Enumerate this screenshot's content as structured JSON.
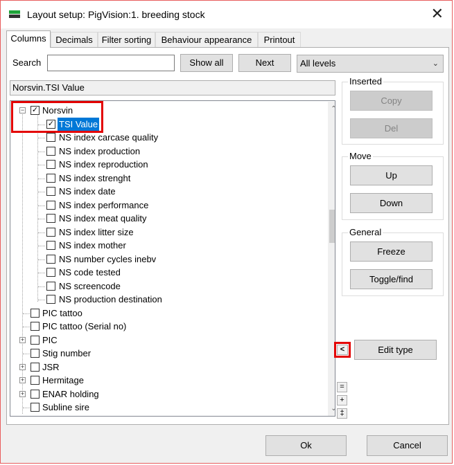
{
  "window": {
    "title": "Layout setup: PigVision:1. breeding stock"
  },
  "tabs": [
    {
      "label": "Columns",
      "active": true
    },
    {
      "label": "Decimals"
    },
    {
      "label": "Filter sorting"
    },
    {
      "label": "Behaviour  appearance"
    },
    {
      "label": "Printout"
    }
  ],
  "search": {
    "label": "Search",
    "value": ""
  },
  "buttons": {
    "show_all": "Show all",
    "next": "Next",
    "copy": "Copy",
    "del": "Del",
    "up": "Up",
    "down": "Down",
    "freeze": "Freeze",
    "toggle_find": "Toggle/find",
    "edit_type": "Edit type",
    "ok": "Ok",
    "cancel": "Cancel",
    "collapse_arrow": "<",
    "minus": "=",
    "plus": "+",
    "pm": "‡"
  },
  "levels_select": {
    "value": "All levels"
  },
  "path": "Norsvin.TSI Value",
  "groups": {
    "inserted": "Inserted",
    "move": "Move",
    "general": "General"
  },
  "tree": {
    "root": {
      "label": "Norsvin",
      "checked": true,
      "expanded": true
    },
    "children": [
      {
        "label": "TSI Value",
        "checked": true,
        "selected": true
      },
      {
        "label": "NS index carcase quality",
        "checked": false
      },
      {
        "label": "NS index production",
        "checked": false
      },
      {
        "label": "NS index reproduction",
        "checked": false
      },
      {
        "label": "NS index strenght",
        "checked": false
      },
      {
        "label": "NS index date",
        "checked": false
      },
      {
        "label": "NS index performance",
        "checked": false
      },
      {
        "label": "NS index meat quality",
        "checked": false
      },
      {
        "label": "NS index litter size",
        "checked": false
      },
      {
        "label": "NS index mother",
        "checked": false
      },
      {
        "label": "NS number cycles inebv",
        "checked": false
      },
      {
        "label": "NS code tested",
        "checked": false
      },
      {
        "label": "NS screencode",
        "checked": false
      },
      {
        "label": "NS production destination",
        "checked": false
      }
    ],
    "siblings": [
      {
        "label": "PIC tattoo",
        "expandable": false
      },
      {
        "label": "PIC tattoo (Serial no)",
        "expandable": false
      },
      {
        "label": "PIC",
        "expandable": true
      },
      {
        "label": "Stig number",
        "expandable": false
      },
      {
        "label": "JSR",
        "expandable": true
      },
      {
        "label": "Hermitage",
        "expandable": true
      },
      {
        "label": "ENAR holding",
        "expandable": true
      },
      {
        "label": "Subline sire",
        "expandable": false
      }
    ]
  },
  "icons": {
    "close": "close-icon",
    "check": "checkmark-icon",
    "scroll_up": "chevron-up-icon",
    "scroll_down": "chevron-down-icon",
    "expand": "plus-box-icon",
    "collapse": "minus-box-icon"
  }
}
